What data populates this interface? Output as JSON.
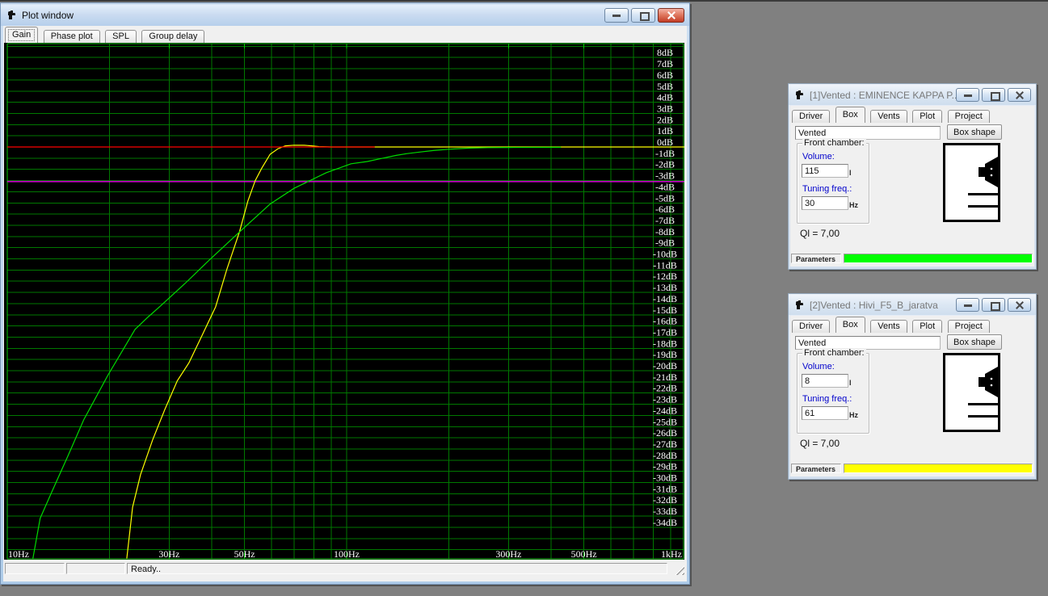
{
  "desktop": {
    "background": "#808080"
  },
  "plot_window": {
    "title": "Plot window",
    "tabs": [
      {
        "label": "Gain"
      },
      {
        "label": "Phase plot"
      },
      {
        "label": "SPL"
      },
      {
        "label": "Group delay"
      }
    ],
    "active_tab": "Gain",
    "status_bar": {
      "ready_text": "Ready.."
    },
    "chart_data": {
      "type": "line",
      "x_scale": "log",
      "x_range": [
        10,
        1000
      ],
      "y_unit": "dB",
      "y_label_range": [
        -34,
        8
      ],
      "y_grid_range": [
        -36,
        9
      ],
      "grid": true,
      "background": "#000000",
      "grid_color": "#007800",
      "border_color": "#00c800",
      "label_color": "#ffffff",
      "x_grid_values": [
        10,
        20,
        30,
        40,
        50,
        60,
        70,
        80,
        90,
        100,
        200,
        300,
        400,
        500,
        600,
        700,
        800,
        900,
        1000
      ],
      "x_ticks": [
        {
          "value": 10,
          "label": "10Hz"
        },
        {
          "value": 30,
          "label": "30Hz"
        },
        {
          "value": 50,
          "label": "50Hz"
        },
        {
          "value": 100,
          "label": "100Hz"
        },
        {
          "value": 300,
          "label": "300Hz"
        },
        {
          "value": 500,
          "label": "500Hz"
        },
        {
          "value": 1000,
          "label": "1kHz"
        }
      ],
      "y_ticks": [
        {
          "value": 8,
          "label": "8dB"
        },
        {
          "value": 7,
          "label": "7dB"
        },
        {
          "value": 6,
          "label": "6dB"
        },
        {
          "value": 5,
          "label": "5dB"
        },
        {
          "value": 4,
          "label": "4dB"
        },
        {
          "value": 3,
          "label": "3dB"
        },
        {
          "value": 2,
          "label": "2dB"
        },
        {
          "value": 1,
          "label": "1dB"
        },
        {
          "value": 0,
          "label": "0dB"
        },
        {
          "value": -1,
          "label": "-1dB"
        },
        {
          "value": -2,
          "label": "-2dB"
        },
        {
          "value": -3,
          "label": "-3dB"
        },
        {
          "value": -4,
          "label": "-4dB"
        },
        {
          "value": -5,
          "label": "-5dB"
        },
        {
          "value": -6,
          "label": "-6dB"
        },
        {
          "value": -7,
          "label": "-7dB"
        },
        {
          "value": -8,
          "label": "-8dB"
        },
        {
          "value": -9,
          "label": "-9dB"
        },
        {
          "value": -10,
          "label": "-10dB"
        },
        {
          "value": -11,
          "label": "-11dB"
        },
        {
          "value": -12,
          "label": "-12dB"
        },
        {
          "value": -13,
          "label": "-13dB"
        },
        {
          "value": -14,
          "label": "-14dB"
        },
        {
          "value": -15,
          "label": "-15dB"
        },
        {
          "value": -16,
          "label": "-16dB"
        },
        {
          "value": -17,
          "label": "-17dB"
        },
        {
          "value": -18,
          "label": "-18dB"
        },
        {
          "value": -19,
          "label": "-19dB"
        },
        {
          "value": -20,
          "label": "-20dB"
        },
        {
          "value": -21,
          "label": "-21dB"
        },
        {
          "value": -22,
          "label": "-22dB"
        },
        {
          "value": -23,
          "label": "-23dB"
        },
        {
          "value": -24,
          "label": "-24dB"
        },
        {
          "value": -25,
          "label": "-25dB"
        },
        {
          "value": -26,
          "label": "-26dB"
        },
        {
          "value": -27,
          "label": "-27dB"
        },
        {
          "value": -28,
          "label": "-28dB"
        },
        {
          "value": -29,
          "label": "-29dB"
        },
        {
          "value": -30,
          "label": "-30dB"
        },
        {
          "value": -31,
          "label": "-31dB"
        },
        {
          "value": -32,
          "label": "-32dB"
        },
        {
          "value": -33,
          "label": "-33dB"
        },
        {
          "value": -34,
          "label": "-34dB"
        }
      ],
      "series": [
        {
          "name": "marker-minus-3db",
          "color": "#ff00ff",
          "points": [
            [
              10,
              -3.1
            ],
            [
              1000,
              -3.1
            ]
          ]
        },
        {
          "name": "gain-project-2-hivi",
          "color": "#ffff00",
          "points": [
            [
              22.5,
              -36.8
            ],
            [
              23.4,
              -32.2
            ],
            [
              24.7,
              -29.3
            ],
            [
              26.8,
              -26.2
            ],
            [
              29.1,
              -23.5
            ],
            [
              31.7,
              -20.9
            ],
            [
              34.3,
              -19.3
            ],
            [
              37.3,
              -17.0
            ],
            [
              41.1,
              -14.3
            ],
            [
              44.4,
              -10.9
            ],
            [
              48.3,
              -7.6
            ],
            [
              51.2,
              -4.8
            ],
            [
              53.8,
              -3.0
            ],
            [
              56.2,
              -1.9
            ],
            [
              59.5,
              -0.65
            ],
            [
              62.8,
              -0.15
            ],
            [
              66,
              0.1
            ],
            [
              70,
              0.16
            ],
            [
              75,
              0.15
            ],
            [
              79,
              0.1
            ],
            [
              83,
              0.03
            ],
            [
              90,
              0
            ],
            [
              120,
              0
            ],
            [
              1000,
              0
            ]
          ]
        },
        {
          "name": "gain-project-1-eminence",
          "color": "#00dc00",
          "points": [
            [
              11.9,
              -36.8
            ],
            [
              12.5,
              -33.2
            ],
            [
              13.5,
              -30.9
            ],
            [
              15.1,
              -27.6
            ],
            [
              16.8,
              -24.4
            ],
            [
              19.8,
              -20.4
            ],
            [
              23.8,
              -16.3
            ],
            [
              26,
              -15.2
            ],
            [
              28.3,
              -14.2
            ],
            [
              33.4,
              -12.2
            ],
            [
              39.4,
              -10.1
            ],
            [
              48.3,
              -7.6
            ],
            [
              59.5,
              -5.1
            ],
            [
              70,
              -3.7
            ],
            [
              87,
              -2.3
            ],
            [
              103,
              -1.5
            ],
            [
              115,
              -1.3
            ],
            [
              128,
              -1.0
            ],
            [
              140,
              -0.75
            ],
            [
              150,
              -0.6
            ],
            [
              165,
              -0.45
            ],
            [
              180,
              -0.32
            ],
            [
              200,
              -0.2
            ],
            [
              230,
              -0.1
            ],
            [
              260,
              -0.06
            ],
            [
              300,
              -0.04
            ],
            [
              428,
              -0.03
            ]
          ]
        },
        {
          "name": "marker-0db",
          "color": "#ff0000",
          "points": [
            [
              10,
              0
            ],
            [
              121,
              0
            ]
          ]
        }
      ]
    }
  },
  "project_windows": [
    {
      "title": "[1]Vented : EMINENCE KAPPA P...",
      "tabs": [
        {
          "label": "Driver"
        },
        {
          "label": "Box"
        },
        {
          "label": "Vents"
        },
        {
          "label": "Plot"
        },
        {
          "label": "Project"
        }
      ],
      "active_tab": "Box",
      "box_type_value": "Vented",
      "box_shape_button": "Box shape",
      "front_chamber": {
        "group_label": "Front chamber:",
        "volume_label": "Volume:",
        "volume_value": "115",
        "volume_unit": "l",
        "tuning_label": "Tuning freq.:",
        "tuning_value": "30",
        "tuning_unit": "Hz"
      },
      "ql_text": "Ql = 7,00",
      "parameters_label": "Parameters",
      "parameters_bar_color": "#00ff00"
    },
    {
      "title": "[2]Vented : Hivi_F5_B_jaratva",
      "tabs": [
        {
          "label": "Driver"
        },
        {
          "label": "Box"
        },
        {
          "label": "Vents"
        },
        {
          "label": "Plot"
        },
        {
          "label": "Project"
        }
      ],
      "active_tab": "Box",
      "box_type_value": "Vented",
      "box_shape_button": "Box shape",
      "front_chamber": {
        "group_label": "Front chamber:",
        "volume_label": "Volume:",
        "volume_value": "8",
        "volume_unit": "l",
        "tuning_label": "Tuning freq.:",
        "tuning_value": "61",
        "tuning_unit": "Hz"
      },
      "ql_text": "Ql = 7,00",
      "parameters_label": "Parameters",
      "parameters_bar_color": "#ffff00"
    }
  ]
}
